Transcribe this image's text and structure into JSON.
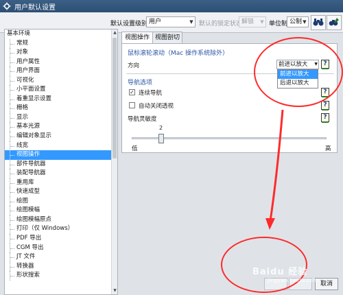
{
  "window": {
    "title": "用户默认设置"
  },
  "toolbar": {
    "level_label": "默认设置级别",
    "level_value": "用户",
    "lock_label": "默认的锁定状态",
    "lock_value": "解锁",
    "unit_label": "单位制",
    "unit_value": "公制"
  },
  "sidebar": {
    "root": "基本环境",
    "items": [
      "常规",
      "对象",
      "用户属性",
      "用户界面",
      "可视化",
      "小平面设置",
      "着重显示设置",
      "栅格",
      "显示",
      "基本光源",
      "编辑对象显示",
      "线宽",
      "视图操作",
      "部件导航器",
      "装配导航器",
      "重用库",
      "快速成型",
      "绘图",
      "绘图模幅",
      "绘图模幅原点",
      "打印（仅 Windows）",
      "PDF 导出",
      "CGM 导出",
      "JT 文件",
      "转换器",
      "形状搜索"
    ],
    "selected": "视图操作"
  },
  "tabs": [
    "视图操作",
    "视图剖切"
  ],
  "panel": {
    "wheel_section": "鼠标滚轮滚动（Mac 操作系统除外）",
    "direction_label": "方向",
    "direction_value": "前进以放大",
    "direction_options": [
      "前进以放大",
      "后退以放大"
    ],
    "nav_section": "导航选项",
    "continuous_nav": "连续导航",
    "continuous_nav_checked": true,
    "auto_perspective": "自动关闭透视",
    "auto_perspective_checked": false,
    "sensitivity_label": "导航灵敏度",
    "sensitivity_value": "2",
    "slider_low": "低",
    "slider_high": "高",
    "help_glyph": "?"
  },
  "footer": {
    "cancel": "取消"
  },
  "watermark": {
    "text": "Baidu 经验",
    "url": "jingyan.baidu.com"
  },
  "colors": {
    "annotation": "#ff2a2a",
    "selection": "#3399ff",
    "titlebar": "#2d4f74"
  }
}
